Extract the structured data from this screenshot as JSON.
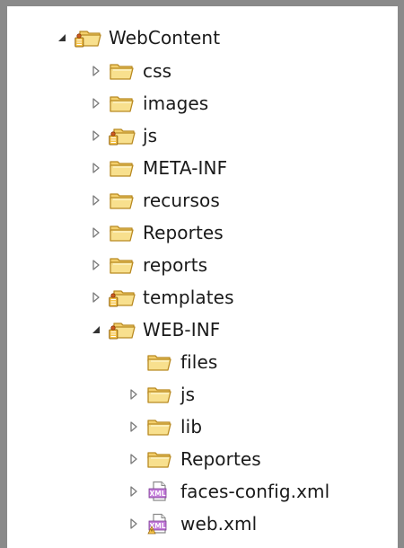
{
  "tree": {
    "root": {
      "label": "WebContent",
      "icon": "package-folder-icon",
      "expanded": true
    },
    "items": [
      {
        "label": "css",
        "icon": "folder-icon",
        "expanded": false
      },
      {
        "label": "images",
        "icon": "folder-icon",
        "expanded": false
      },
      {
        "label": "js",
        "icon": "package-folder-icon",
        "expanded": false
      },
      {
        "label": "META-INF",
        "icon": "folder-icon",
        "expanded": false
      },
      {
        "label": "recursos",
        "icon": "folder-icon",
        "expanded": false
      },
      {
        "label": "Reportes",
        "icon": "folder-icon",
        "expanded": false
      },
      {
        "label": "reports",
        "icon": "folder-icon",
        "expanded": false
      },
      {
        "label": "templates",
        "icon": "package-folder-icon",
        "expanded": false
      },
      {
        "label": "WEB-INF",
        "icon": "package-folder-icon",
        "expanded": true
      }
    ],
    "webinf_children": [
      {
        "label": "files",
        "icon": "folder-icon",
        "has_children": false
      },
      {
        "label": "js",
        "icon": "folder-icon",
        "has_children": true
      },
      {
        "label": "lib",
        "icon": "folder-icon",
        "has_children": true
      },
      {
        "label": "Reportes",
        "icon": "folder-icon",
        "has_children": true
      },
      {
        "label": "faces-config.xml",
        "icon": "xml-file-icon",
        "has_children": true
      },
      {
        "label": "web.xml",
        "icon": "xml-file-warning-icon",
        "has_children": true
      }
    ]
  },
  "colors": {
    "folder_fill": "#f5d77a",
    "folder_stroke": "#b98a22",
    "frame_border": "#8a8a8a",
    "text": "#1a1a1a",
    "twisty": "#7a7a7a"
  }
}
